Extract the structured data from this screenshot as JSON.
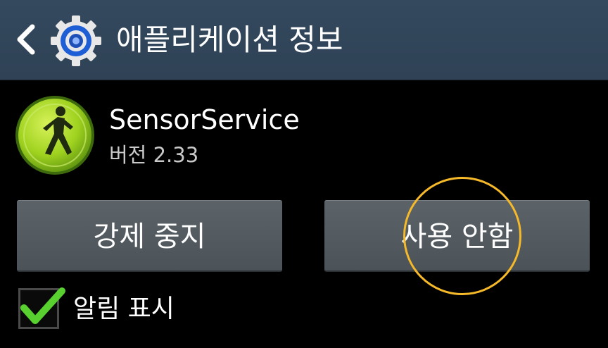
{
  "header": {
    "title": "애플리케이션 정보",
    "back_icon": "chevron-left-icon",
    "settings_icon": "gear-icon"
  },
  "app": {
    "name": "SensorService",
    "version": "버전 2.33",
    "icon": "walking-person-icon"
  },
  "buttons": {
    "force_stop": "강제 중지",
    "disable": "사용 안함"
  },
  "notification": {
    "label": "알림 표시",
    "checked": true
  },
  "colors": {
    "header_bg": "#34495e",
    "button_bg": "#575f65",
    "highlight_circle": "#f5b92a",
    "checkmark": "#58d02f",
    "app_icon_green": "#9fd21f"
  }
}
